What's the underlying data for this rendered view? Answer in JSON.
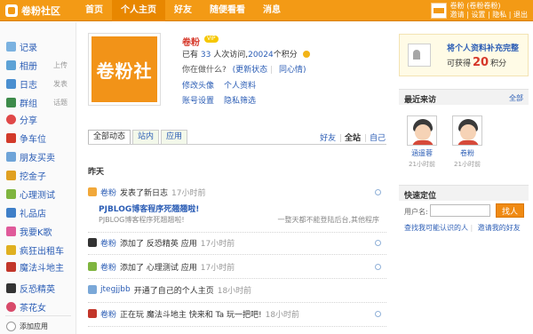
{
  "app": {
    "logo": "卷粉社区"
  },
  "nav": [
    "首页",
    "个人主页",
    "好友",
    "随便看看",
    "消息"
  ],
  "user_menu": {
    "name_line": "卷粉 (卷粉卷粉)",
    "links": [
      "邀请",
      "设置",
      "隐私",
      "退出"
    ]
  },
  "sidebar": {
    "items": [
      {
        "label": "记录",
        "icon": "note-icon",
        "extra": ""
      },
      {
        "label": "相册",
        "icon": "photo-icon",
        "extra": "上传"
      },
      {
        "label": "日志",
        "icon": "blog-icon",
        "extra": "发表"
      },
      {
        "label": "群组",
        "icon": "group-icon",
        "extra": "话题"
      },
      {
        "label": "分享",
        "icon": "share-icon",
        "extra": ""
      },
      {
        "label": "争车位",
        "icon": "car-icon",
        "extra": ""
      },
      {
        "label": "朋友买卖",
        "icon": "trade-icon",
        "extra": ""
      },
      {
        "label": "挖金子",
        "icon": "gold-icon",
        "extra": ""
      },
      {
        "label": "心理测试",
        "icon": "flask-icon",
        "extra": ""
      },
      {
        "label": "礼品店",
        "icon": "gift-icon",
        "extra": ""
      },
      {
        "label": "我要K歌",
        "icon": "karaoke-icon",
        "extra": ""
      },
      {
        "label": "疯狂出租车",
        "icon": "taxi-icon",
        "extra": ""
      },
      {
        "label": "魔法斗地主",
        "icon": "poker-icon",
        "extra": ""
      },
      {
        "label": "反恐精英",
        "icon": "cs-icon",
        "extra": ""
      },
      {
        "label": "茶花女",
        "icon": "flower-icon",
        "extra": ""
      },
      {
        "label": "添加应用",
        "icon": "add-icon",
        "extra": ""
      }
    ]
  },
  "profile": {
    "avatar_text": "卷粉社",
    "name": "卷粉",
    "badge": "VIP",
    "stats": {
      "prefix": "已有",
      "visits": "33",
      "mid": "人次访问,",
      "points": "20024",
      "suffix": "个积分"
    },
    "status_prompt": "你在做什么?",
    "status_links": [
      "(更新状态",
      "|",
      "同心情)"
    ],
    "links": {
      "edit_avatar": "修改头像",
      "profile": "个人资料",
      "account": "账号设置",
      "privacy": "隐私筛选"
    }
  },
  "tabs": [
    "全部动态",
    "站内",
    "应用"
  ],
  "filters": {
    "friends": "好友",
    "all": "全站",
    "mine": "自己"
  },
  "feed": {
    "day": "昨天",
    "items": [
      {
        "icon": "blog-icon",
        "name": "卷粉",
        "text": "发表了新日志",
        "time": "17小时前"
      },
      {
        "icon": "cs-icon",
        "name": "卷粉",
        "text": "添加了 反恐精英 应用",
        "time": "17小时前"
      },
      {
        "icon": "flask-icon",
        "name": "卷粉",
        "text": "添加了 心理测试 应用",
        "time": "17小时前"
      },
      {
        "icon": "profile-icon",
        "name": "jtegjjbb",
        "text": "开通了自己的个人主页",
        "time": "18小时前"
      },
      {
        "icon": "poker-icon",
        "name": "卷粉",
        "text": "正在玩 魔法斗地主 快来和 Ta 玩一把吧!",
        "time": "18小时前"
      }
    ],
    "blog": {
      "title": "PJBLOG博客程序死翘翘啦!",
      "excerpt_left": "PJBLOG博客程序死翘翘啦!",
      "excerpt_right": "一整天都不能登陆后台,其他程序"
    }
  },
  "promo": {
    "title": "将个人资料补充完整",
    "prefix": "可获得",
    "points": "20",
    "unit": "积分"
  },
  "visitors": {
    "title": "最近来访",
    "more": "全部",
    "items": [
      {
        "name": "涵遥蓉",
        "time": "21小时前"
      },
      {
        "name": "卷粉",
        "time": "21小时前"
      }
    ]
  },
  "locate": {
    "title": "快速定位",
    "label": "用户名:",
    "button": "找人",
    "links": [
      "查找我可能认识的人",
      "|",
      "邀请我的好友"
    ]
  },
  "colors": {
    "brand": "#f39a15",
    "link": "#2b5db5",
    "accent_red": "#d6382a"
  }
}
